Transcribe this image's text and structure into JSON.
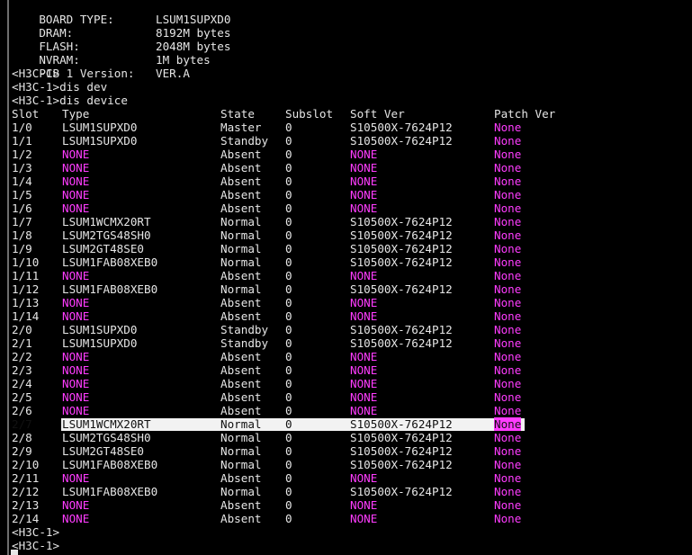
{
  "header": [
    {
      "label": "BOARD TYPE:",
      "value": "LSUM1SUPXD0"
    },
    {
      "label": "DRAM:",
      "value": "8192M bytes"
    },
    {
      "label": "FLASH:",
      "value": "2048M bytes"
    },
    {
      "label": "NVRAM:",
      "value": "1M bytes"
    },
    {
      "label": "PCB 1 Version:",
      "value": "VER.A"
    }
  ],
  "session": [
    "<H3C-1>",
    "<H3C-1>dis dev",
    "<H3C-1>dis device"
  ],
  "table": {
    "columns": [
      "Slot",
      "Type",
      "State",
      "Subslot",
      "Soft Ver",
      "Patch Ver"
    ],
    "rows": [
      [
        "1/0",
        "LSUM1SUPXD0",
        "Master",
        "0",
        "S10500X-7624P12",
        "None"
      ],
      [
        "1/1",
        "LSUM1SUPXD0",
        "Standby",
        "0",
        "S10500X-7624P12",
        "None"
      ],
      [
        "1/2",
        "NONE",
        "Absent",
        "0",
        "NONE",
        "None"
      ],
      [
        "1/3",
        "NONE",
        "Absent",
        "0",
        "NONE",
        "None"
      ],
      [
        "1/4",
        "NONE",
        "Absent",
        "0",
        "NONE",
        "None"
      ],
      [
        "1/5",
        "NONE",
        "Absent",
        "0",
        "NONE",
        "None"
      ],
      [
        "1/6",
        "NONE",
        "Absent",
        "0",
        "NONE",
        "None"
      ],
      [
        "1/7",
        "LSUM1WCMX20RT",
        "Normal",
        "0",
        "S10500X-7624P12",
        "None"
      ],
      [
        "1/8",
        "LSUM2TGS48SH0",
        "Normal",
        "0",
        "S10500X-7624P12",
        "None"
      ],
      [
        "1/9",
        "LSUM2GT48SE0",
        "Normal",
        "0",
        "S10500X-7624P12",
        "None"
      ],
      [
        "1/10",
        "LSUM1FAB08XEB0",
        "Normal",
        "0",
        "S10500X-7624P12",
        "None"
      ],
      [
        "1/11",
        "NONE",
        "Absent",
        "0",
        "NONE",
        "None"
      ],
      [
        "1/12",
        "LSUM1FAB08XEB0",
        "Normal",
        "0",
        "S10500X-7624P12",
        "None"
      ],
      [
        "1/13",
        "NONE",
        "Absent",
        "0",
        "NONE",
        "None"
      ],
      [
        "1/14",
        "NONE",
        "Absent",
        "0",
        "NONE",
        "None"
      ],
      [
        "2/0",
        "LSUM1SUPXD0",
        "Standby",
        "0",
        "S10500X-7624P12",
        "None"
      ],
      [
        "2/1",
        "LSUM1SUPXD0",
        "Standby",
        "0",
        "S10500X-7624P12",
        "None"
      ],
      [
        "2/2",
        "NONE",
        "Absent",
        "0",
        "NONE",
        "None"
      ],
      [
        "2/3",
        "NONE",
        "Absent",
        "0",
        "NONE",
        "None"
      ],
      [
        "2/4",
        "NONE",
        "Absent",
        "0",
        "NONE",
        "None"
      ],
      [
        "2/5",
        "NONE",
        "Absent",
        "0",
        "NONE",
        "None"
      ],
      [
        "2/6",
        "NONE",
        "Absent",
        "0",
        "NONE",
        "None"
      ],
      [
        "2/7",
        "LSUM1WCMX20RT",
        "Normal",
        "0",
        "S10500X-7624P12",
        "None"
      ],
      [
        "2/8",
        "LSUM2TGS48SH0",
        "Normal",
        "0",
        "S10500X-7624P12",
        "None"
      ],
      [
        "2/9",
        "LSUM2GT48SE0",
        "Normal",
        "0",
        "S10500X-7624P12",
        "None"
      ],
      [
        "2/10",
        "LSUM1FAB08XEB0",
        "Normal",
        "0",
        "S10500X-7624P12",
        "None"
      ],
      [
        "2/11",
        "NONE",
        "Absent",
        "0",
        "NONE",
        "None"
      ],
      [
        "2/12",
        "LSUM1FAB08XEB0",
        "Normal",
        "0",
        "S10500X-7624P12",
        "None"
      ],
      [
        "2/13",
        "NONE",
        "Absent",
        "0",
        "NONE",
        "None"
      ],
      [
        "2/14",
        "NONE",
        "Absent",
        "0",
        "NONE",
        "None"
      ]
    ],
    "selected_row": "2/7"
  },
  "trailer": [
    "<H3C-1>",
    "<H3C-1>"
  ],
  "colors": {
    "background": "#000000",
    "text": "#e6e6e6",
    "highlight_value": "#ff3cff",
    "selection": "#f2f2f2"
  }
}
